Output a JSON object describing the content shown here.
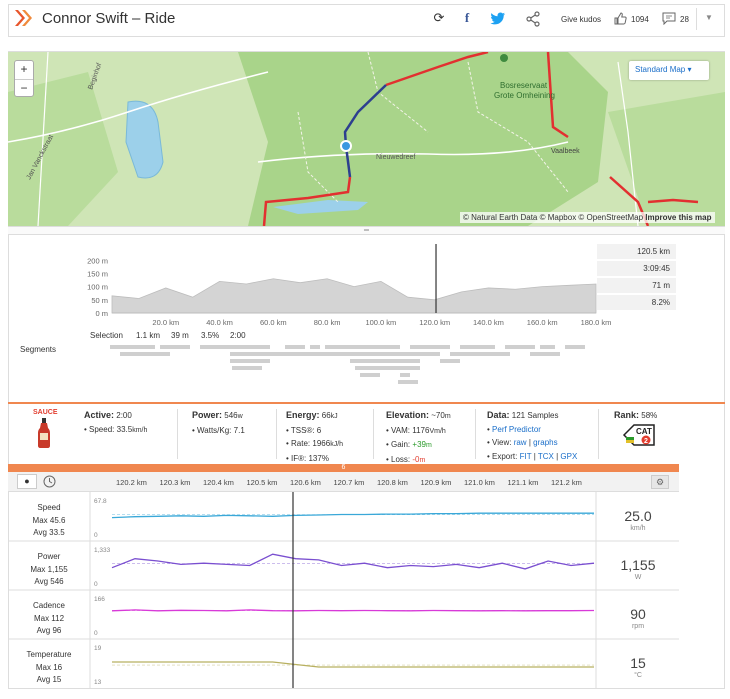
{
  "header": {
    "title": "Connor Swift – Ride",
    "kudos_label": "Give kudos",
    "kudos_count": "1094",
    "comment_count": "28"
  },
  "map": {
    "zoom_in": "+",
    "zoom_out": "−",
    "map_type": "Standard Map ▾",
    "label_bosreservaat": "Bosreservaat",
    "label_grote": "Grote Omheining",
    "label_vaalbeek": "Vaalbeek",
    "label_nieuwedreef": "Nieuwedreef",
    "label_vanvanck": "Jan Vanckstraat",
    "label_begijnhof": "Beginhof",
    "attr_ne": "© Natural Earth Data",
    "attr_mb": "© Mapbox",
    "attr_osm": "© OpenStreetMap",
    "attr_improve": "Improve this map"
  },
  "elevation": {
    "y_ticks": [
      "200 m",
      "150 m",
      "100 m",
      "50 m",
      "0 m"
    ],
    "x_ticks": [
      "20.0 km",
      "40.0 km",
      "60.0 km",
      "80.0 km",
      "100.0 km",
      "120.0 km",
      "140.0 km",
      "160.0 km",
      "180.0 km"
    ],
    "stats": [
      "120.5 km",
      "3:09:45",
      "71 m",
      "8.2%"
    ],
    "segments_label": "Segments",
    "selection": {
      "label": "Selection",
      "distance": "1.1 km",
      "elevation": "39 m",
      "grade": "3.5%",
      "time": "2:00"
    }
  },
  "summary": {
    "sauce": "SAUCE",
    "active_label": "Active:",
    "active_value": "2:00",
    "speed_label": "• Speed:",
    "speed_value": "33.5",
    "speed_unit": "km/h",
    "power_label": "Power:",
    "power_value": "546",
    "power_unit": "w",
    "wkg_label": "• Watts/Kg:",
    "wkg_value": "7.1",
    "energy_label": "Energy:",
    "energy_value": "66",
    "energy_unit": "kJ",
    "tss_label": "• TSS®:",
    "tss_value": "6",
    "rate_label": "• Rate:",
    "rate_value": "1966",
    "rate_unit": "kJ/h",
    "if_label": "• IF®:",
    "if_value": "137%",
    "elev_label": "Elevation:",
    "elev_value": "~70",
    "elev_unit": "m",
    "vam_label": "• VAM:",
    "vam_value": "1176",
    "vam_unit": "Vm/h",
    "gain_label": "• Gain:",
    "gain_value": "+39",
    "gain_unit": "m",
    "loss_label": "• Loss:",
    "loss_value": "-0",
    "loss_unit": "m",
    "data_label": "Data:",
    "data_value": "121 Samples",
    "perf_label": "Perf Predictor",
    "view_label": "• View:",
    "view_raw": "raw",
    "view_sep": "|",
    "view_graphs": "graphs",
    "export_label": "• Export:",
    "export_fit": "FIT",
    "export_tcx": "TCX",
    "export_gpx": "GPX",
    "rank_label": "Rank:",
    "rank_value": "58%",
    "rank_cat": "CAT",
    "rank_num": "2"
  },
  "timeline": {
    "ticks": [
      "120.2 km",
      "120.3 km",
      "120.4 km",
      "120.5 km",
      "120.6 km",
      "120.7 km",
      "120.8 km",
      "120.9 km",
      "121.0 km",
      "121.1 km",
      "121.2 km"
    ],
    "handle": "6"
  },
  "rows": [
    {
      "name": "Speed",
      "max": "Max 45.6",
      "avg": "Avg 33.5",
      "value": "25.0",
      "unit": "km/h",
      "ymax": "67.8",
      "ymin": "0",
      "color": "#3aa8d8"
    },
    {
      "name": "Power",
      "max": "Max 1,155",
      "avg": "Avg 546",
      "value": "1,155",
      "unit": "W",
      "ymax": "1,333",
      "ymin": "0",
      "color": "#7a4fd0"
    },
    {
      "name": "Cadence",
      "max": "Max 112",
      "avg": "Avg 96",
      "value": "90",
      "unit": "rpm",
      "ymax": "166",
      "ymin": "0",
      "color": "#d83ad8"
    },
    {
      "name": "Temperature",
      "max": "Max 16",
      "avg": "Avg 15",
      "value": "15",
      "unit": "°C",
      "ymax": "19",
      "ymin": "13",
      "color": "#b8b060"
    }
  ],
  "chart_data": [
    {
      "type": "area",
      "title": "",
      "xlabel": "",
      "ylabel": "",
      "xlim": [
        0,
        180
      ],
      "ylim": [
        0,
        220
      ],
      "x": [
        0,
        10,
        20,
        30,
        40,
        50,
        60,
        70,
        80,
        90,
        100,
        110,
        120,
        130,
        140,
        150,
        160,
        170,
        180
      ],
      "values": [
        65,
        55,
        95,
        60,
        120,
        110,
        130,
        115,
        130,
        100,
        120,
        60,
        50,
        80,
        95,
        90,
        100,
        105,
        110
      ],
      "marker_x": 120.5
    },
    {
      "type": "line",
      "name": "Speed",
      "ylim": [
        0,
        67.8
      ],
      "values": [
        28,
        30,
        31,
        32,
        31,
        33,
        32,
        31,
        33,
        34,
        35,
        35,
        36,
        36,
        37,
        37,
        38,
        38,
        38,
        38,
        38,
        38
      ]
    },
    {
      "type": "line",
      "name": "Power",
      "ylim": [
        0,
        1333
      ],
      "values": [
        500,
        900,
        800,
        650,
        700,
        650,
        600,
        1100,
        900,
        850,
        600,
        700,
        500,
        600,
        550,
        650,
        500,
        700,
        450,
        800,
        600,
        700
      ]
    },
    {
      "type": "line",
      "name": "Cadence",
      "ylim": [
        0,
        166
      ],
      "values": [
        95,
        100,
        95,
        98,
        97,
        95,
        100,
        96,
        95,
        97,
        96,
        97,
        96,
        95,
        97,
        96,
        95,
        96,
        95,
        96,
        96,
        97
      ]
    },
    {
      "type": "line",
      "name": "Temperature",
      "ylim": [
        13,
        19
      ],
      "values": [
        16,
        16,
        16,
        16,
        16,
        16,
        16,
        16,
        15.5,
        15,
        15,
        15,
        15,
        15,
        15,
        15,
        15,
        15,
        15,
        15,
        15,
        15
      ]
    }
  ]
}
